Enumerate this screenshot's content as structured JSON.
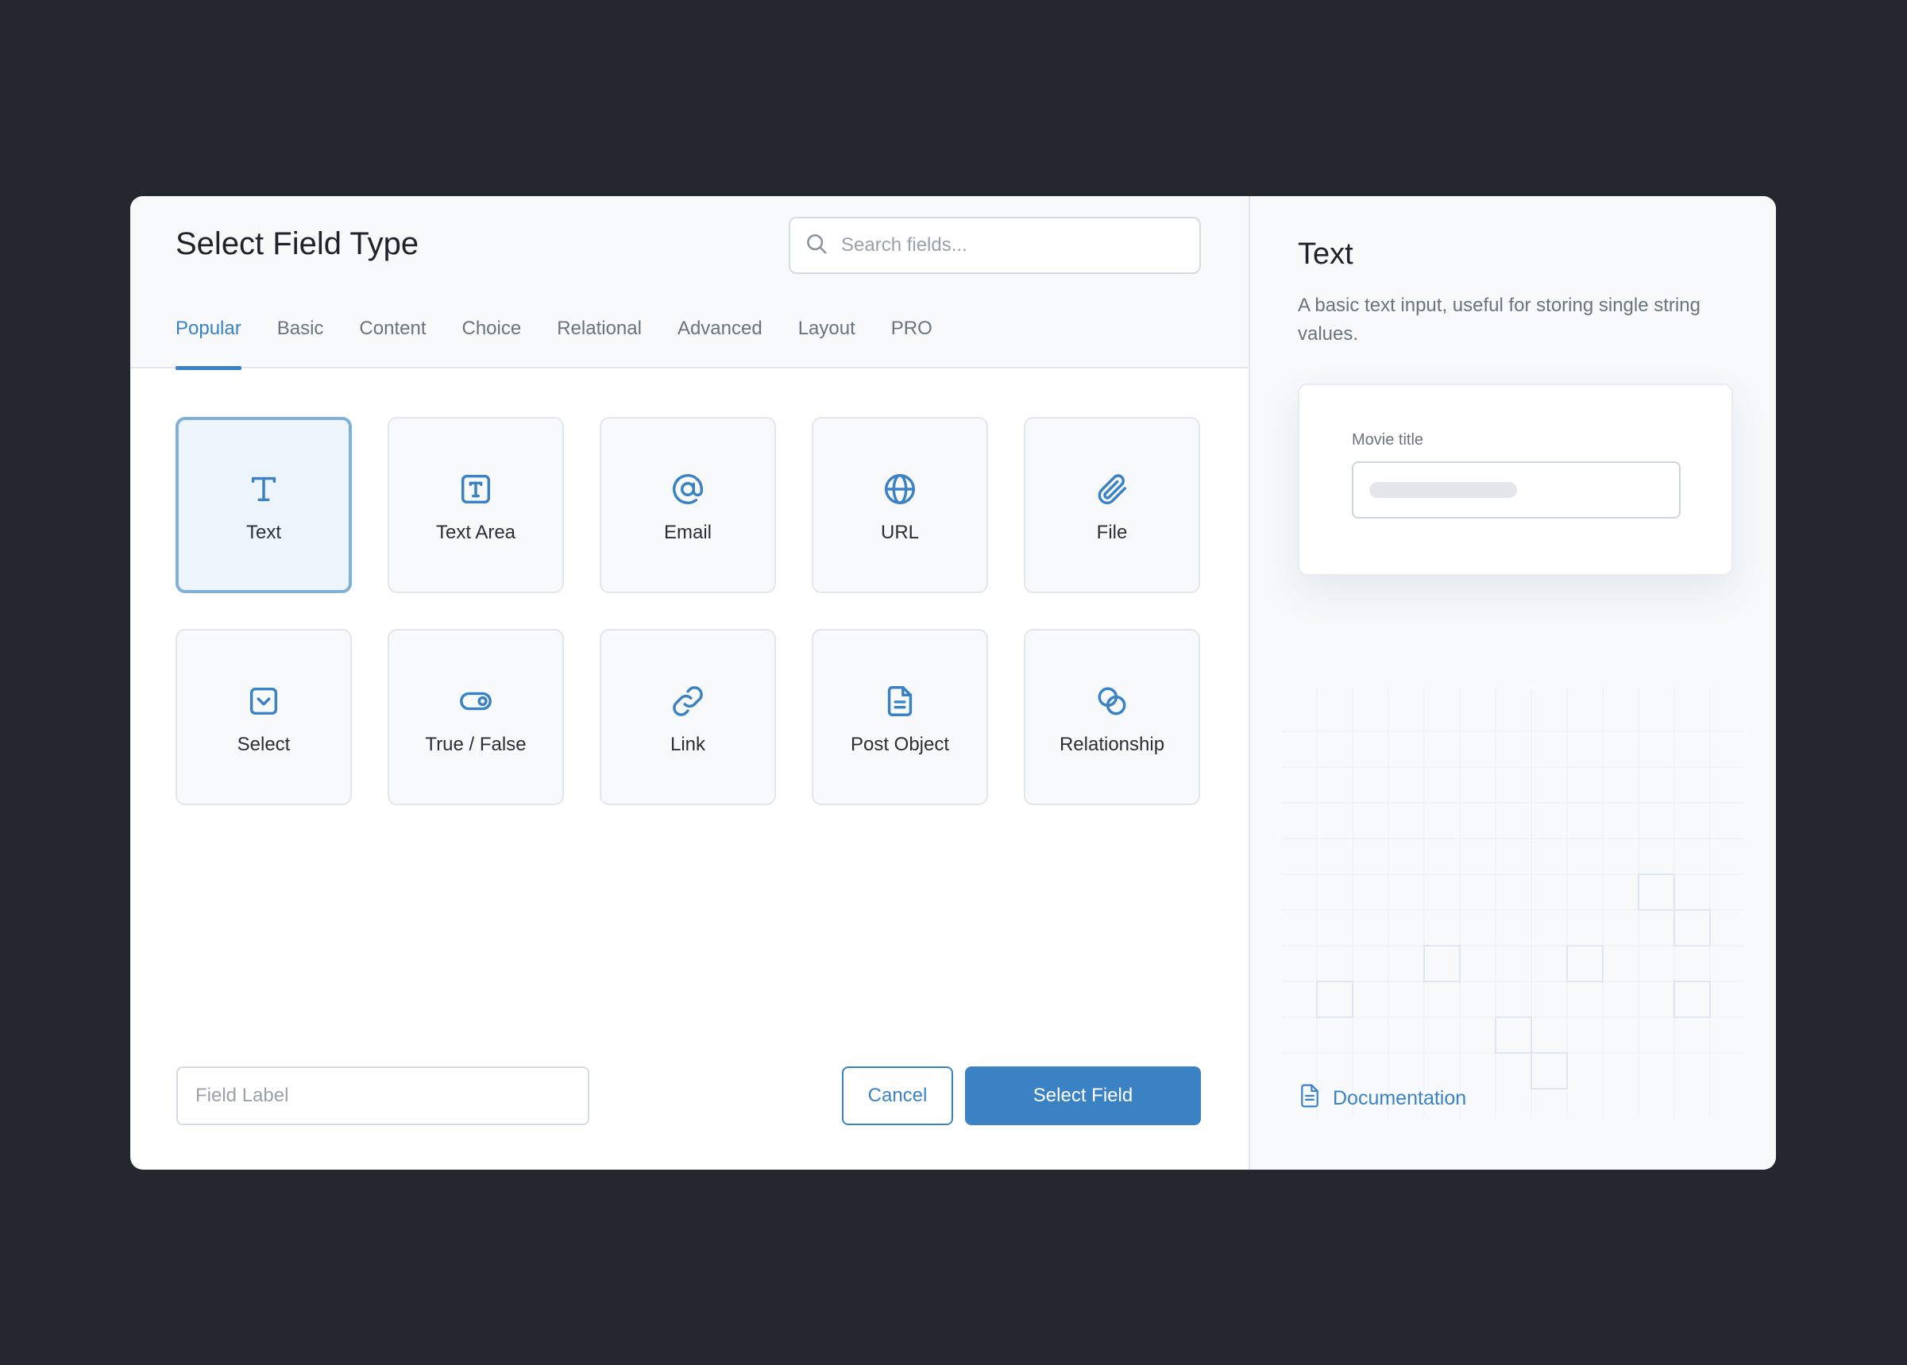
{
  "dialog": {
    "title": "Select Field Type",
    "search": {
      "placeholder": "Search fields..."
    },
    "tabs": [
      {
        "label": "Popular",
        "active": true
      },
      {
        "label": "Basic"
      },
      {
        "label": "Content"
      },
      {
        "label": "Choice"
      },
      {
        "label": "Relational"
      },
      {
        "label": "Advanced"
      },
      {
        "label": "Layout"
      },
      {
        "label": "PRO"
      }
    ],
    "fields": [
      {
        "label": "Text",
        "icon": "text-icon",
        "selected": true
      },
      {
        "label": "Text Area",
        "icon": "text-area-icon"
      },
      {
        "label": "Email",
        "icon": "at-sign-icon"
      },
      {
        "label": "URL",
        "icon": "globe-icon"
      },
      {
        "label": "File",
        "icon": "paperclip-icon"
      },
      {
        "label": "Select",
        "icon": "select-box-icon"
      },
      {
        "label": "True / False",
        "icon": "toggle-icon"
      },
      {
        "label": "Link",
        "icon": "link-icon"
      },
      {
        "label": "Post Object",
        "icon": "document-icon"
      },
      {
        "label": "Relationship",
        "icon": "relationship-icon"
      }
    ],
    "field_label": {
      "placeholder": "Field Label"
    },
    "cancel_label": "Cancel",
    "select_label": "Select Field"
  },
  "panel": {
    "title": "Text",
    "description": "A basic text input, useful for storing single string values.",
    "preview_label": "Movie title",
    "documentation_label": "Documentation"
  },
  "colors": {
    "accent": "#3a82c3",
    "backdrop": "#24272d",
    "selected_border": "#7fb1d9"
  }
}
